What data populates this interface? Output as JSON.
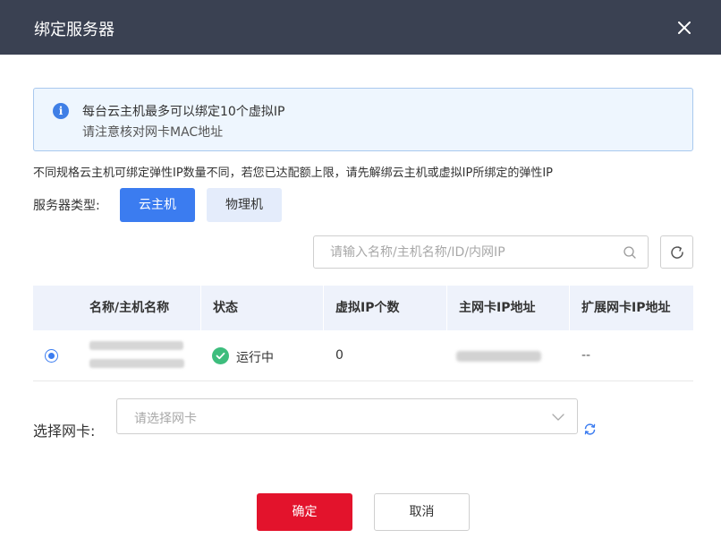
{
  "dialog": {
    "title": "绑定服务器"
  },
  "notice": {
    "line1": "每台云主机最多可以绑定10个虚拟IP",
    "line2": "请注意核对网卡MAC地址"
  },
  "hint": "不同规格云主机可绑定弹性IP数量不同，若您已达配额上限，请先解绑云主机或虚拟IP所绑定的弹性IP",
  "server_type": {
    "label": "服务器类型:",
    "options": [
      "云主机",
      "物理机"
    ],
    "selected": "云主机"
  },
  "search": {
    "placeholder": "请输入名称/主机名称/ID/内网IP"
  },
  "table": {
    "columns": [
      "名称/主机名称",
      "状态",
      "虚拟IP个数",
      "主网卡IP地址",
      "扩展网卡IP地址"
    ],
    "rows": [
      {
        "selected": true,
        "status": "运行中",
        "virtual_ip_count": "0",
        "ext_ip": "--"
      }
    ]
  },
  "nic": {
    "label": "选择网卡:",
    "placeholder": "请选择网卡"
  },
  "footer": {
    "confirm": "确定",
    "cancel": "取消"
  },
  "colors": {
    "header_bg": "#3a4152",
    "primary": "#3b7cf0",
    "confirm": "#e3132c",
    "status_ok": "#3dbd7d"
  }
}
